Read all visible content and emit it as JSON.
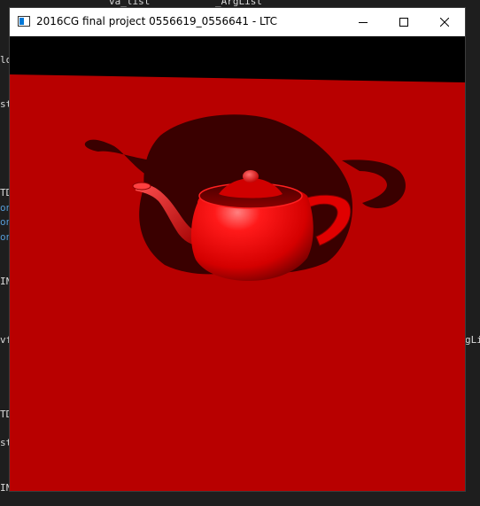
{
  "window": {
    "title": "2016CG final project 0556619_0556641 - LTC",
    "controls": {
      "minimize": "minimize",
      "maximize": "maximize",
      "close": "close"
    }
  },
  "background_editor": {
    "top_fragments": [
      "va_list",
      "_ArgList"
    ],
    "left_fragments": [
      "lo",
      "st",
      "TD",
      "on",
      "on",
      "on",
      "IN",
      "vf",
      "TD",
      "st",
      "IN"
    ],
    "right_fragments": [
      "gLi"
    ]
  },
  "scene": {
    "floor_color": "#b80000",
    "sky_color": "#000000",
    "teapot_color": "#ff1010",
    "shadow_color": "#3a0000",
    "object": "teapot"
  }
}
